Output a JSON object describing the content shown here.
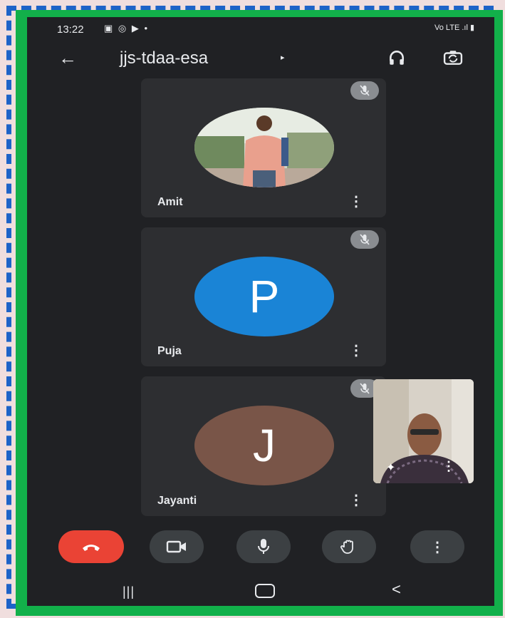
{
  "status_bar": {
    "time": "13:22",
    "icons": [
      "image-icon",
      "whatsapp-icon",
      "youtube-icon",
      "dot-icon"
    ],
    "right_text": "Vo LTE .ıl ▮"
  },
  "app_bar": {
    "title": "jjs-tdaa-esa",
    "caret": "▸",
    "back_glyph": "←"
  },
  "participants": [
    {
      "name": "Amit",
      "avatar_type": "photo",
      "muted": true
    },
    {
      "name": "Puja",
      "avatar_type": "initial",
      "initial": "P",
      "color": "#1a84d6",
      "muted": true
    },
    {
      "name": "Jayanti",
      "avatar_type": "initial",
      "initial": "J",
      "color": "#795548",
      "muted": true
    }
  ],
  "tile_menu_glyph": "⋮",
  "self_view": {
    "effects_glyph": "✦",
    "menu_glyph": "⋮"
  },
  "controls": [
    {
      "name": "end-call",
      "color": "#ea4335"
    },
    {
      "name": "camera"
    },
    {
      "name": "microphone"
    },
    {
      "name": "raise-hand"
    },
    {
      "name": "more-options",
      "glyph": "⋮"
    }
  ],
  "nav": {
    "recents_glyph": "|||",
    "back_glyph": "<"
  },
  "colors": {
    "frame_green": "#12b04a",
    "frame_blue": "#1d63c8",
    "background": "#202124",
    "tile": "#2d2e31"
  }
}
